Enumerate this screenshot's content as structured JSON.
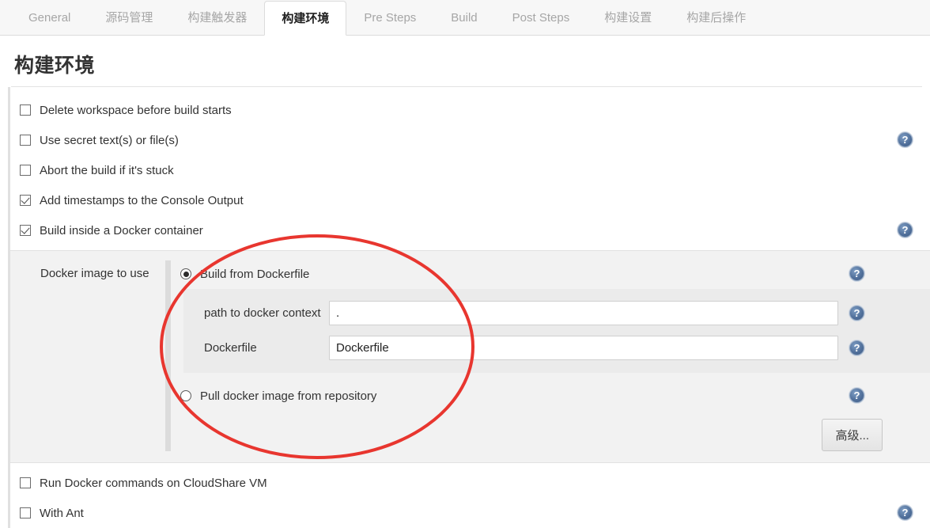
{
  "tabs": [
    {
      "label": "General",
      "active": false
    },
    {
      "label": "源码管理",
      "active": false
    },
    {
      "label": "构建触发器",
      "active": false
    },
    {
      "label": "构建环境",
      "active": true
    },
    {
      "label": "Pre Steps",
      "active": false
    },
    {
      "label": "Build",
      "active": false
    },
    {
      "label": "Post Steps",
      "active": false
    },
    {
      "label": "构建设置",
      "active": false
    },
    {
      "label": "构建后操作",
      "active": false
    }
  ],
  "page": {
    "title": "构建环境"
  },
  "checkboxes": [
    {
      "label": "Delete workspace before build starts",
      "checked": false,
      "help": false
    },
    {
      "label": "Use secret text(s) or file(s)",
      "checked": false,
      "help": true
    },
    {
      "label": "Abort the build if it's stuck",
      "checked": false,
      "help": false
    },
    {
      "label": "Add timestamps to the Console Output",
      "checked": true,
      "help": false
    },
    {
      "label": "Build inside a Docker container",
      "checked": true,
      "help": true
    }
  ],
  "docker_panel": {
    "caption": "Docker image to use",
    "option_build": {
      "label": "Build from Dockerfile",
      "selected": true
    },
    "option_pull": {
      "label": "Pull docker image from repository",
      "selected": false
    },
    "fields": [
      {
        "label": "path to docker context",
        "value": ".",
        "placeholder": ""
      },
      {
        "label": "Dockerfile",
        "value": "Dockerfile",
        "placeholder": ""
      }
    ],
    "advanced_button": "高级..."
  },
  "bottom_checkboxes": [
    {
      "label": "Run Docker commands on CloudShare VM",
      "checked": false,
      "help": false
    },
    {
      "label": "With Ant",
      "checked": false,
      "help": true
    }
  ],
  "annotation": {
    "type": "ellipse",
    "color": "#e8362f"
  },
  "icons": {
    "help": "help-question-icon"
  }
}
